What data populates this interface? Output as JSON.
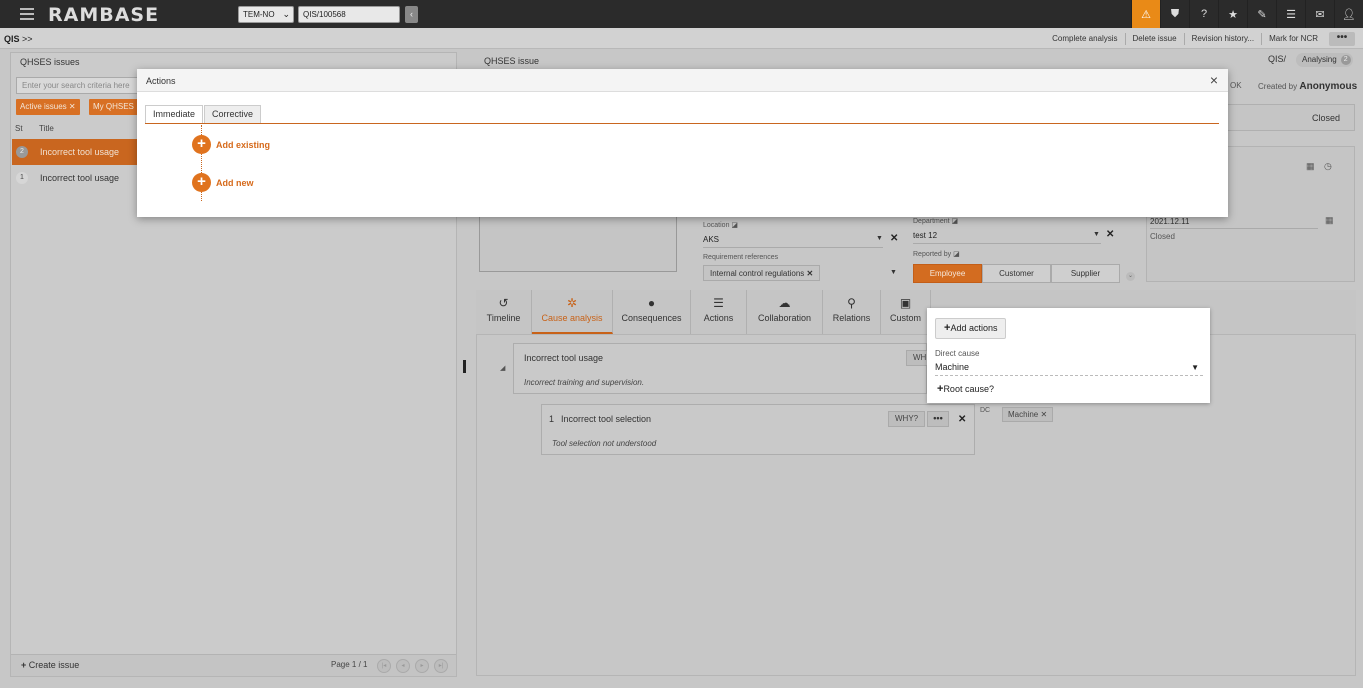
{
  "topbar": {
    "logo": "RAMBASE",
    "company": "TEM-NO",
    "ref": "QIS/100568",
    "icons": [
      "warning-icon",
      "shield-icon",
      "help-icon",
      "star-icon",
      "paperclip-icon",
      "list-icon",
      "mail-icon",
      "user-icon"
    ]
  },
  "subbar": {
    "crumb": "QIS",
    "crumb_sep": ">>",
    "actions": [
      "Complete analysis",
      "Delete issue",
      "Revision history...",
      "Mark for NCR"
    ],
    "more": "•••"
  },
  "left": {
    "title": "QHSES issues",
    "search_placeholder": "Enter your search criteria here",
    "filters": [
      "Active issues",
      "My QHSES"
    ],
    "col_status": "St",
    "col_title": "Title",
    "rows": [
      {
        "status": "2",
        "title": "Incorrect tool usage"
      },
      {
        "status": "1",
        "title": "Incorrect tool usage"
      }
    ],
    "create": "Create issue",
    "pager": "Page 1 / 1"
  },
  "right": {
    "title": "QHSES issue",
    "qis": "QIS/",
    "status": "Analysing",
    "status_num": "2",
    "ok": "OK",
    "created_by_label": "Created by",
    "created_by": "Anonymous",
    "closed": "Closed",
    "date_value": "2021.12.11",
    "date_sub": "Closed",
    "location_label": "Location",
    "location": "AKS",
    "department_label": "Department",
    "department": "test 12",
    "req_label": "Requirement references",
    "req_tag": "Internal control regulations",
    "reported_label": "Reported by",
    "reported_opts": [
      "Employee",
      "Customer",
      "Supplier"
    ]
  },
  "tabs": [
    {
      "label": "Timeline",
      "icon": "history-icon",
      "glyph": "↺"
    },
    {
      "label": "Cause analysis",
      "icon": "cause-analysis-icon",
      "glyph": "✲"
    },
    {
      "label": "Consequences",
      "icon": "exclamation-icon",
      "glyph": "●"
    },
    {
      "label": "Actions",
      "icon": "list-icon",
      "glyph": "☰"
    },
    {
      "label": "Collaboration",
      "icon": "chat-icon",
      "glyph": "☁"
    },
    {
      "label": "Relations",
      "icon": "relations-icon",
      "glyph": "⚲"
    },
    {
      "label": "Custom",
      "icon": "custom-icon",
      "glyph": "▣"
    }
  ],
  "cause": {
    "card1_title": "Incorrect tool usage",
    "card1_text": "Incorrect training and supervision.",
    "card1_why": "WH",
    "card2_num": "1",
    "card2_title": "Incorrect tool selection",
    "card2_text": "Tool selection not understood",
    "why": "WHY?",
    "dots": "•••",
    "dc": "DC",
    "dc_tag": "Machine"
  },
  "popup": {
    "add_actions": "Add actions",
    "direct_cause_label": "Direct cause",
    "direct_cause": "Machine",
    "root_cause": "Root cause?"
  },
  "modal": {
    "title": "Actions",
    "tabs": [
      "Immediate",
      "Corrective"
    ],
    "add_existing": "Add existing",
    "add_new": "Add new"
  },
  "colors": {
    "accent": "#e0731e",
    "topbar": "#2b2b2b",
    "warning": "#e98a17"
  }
}
